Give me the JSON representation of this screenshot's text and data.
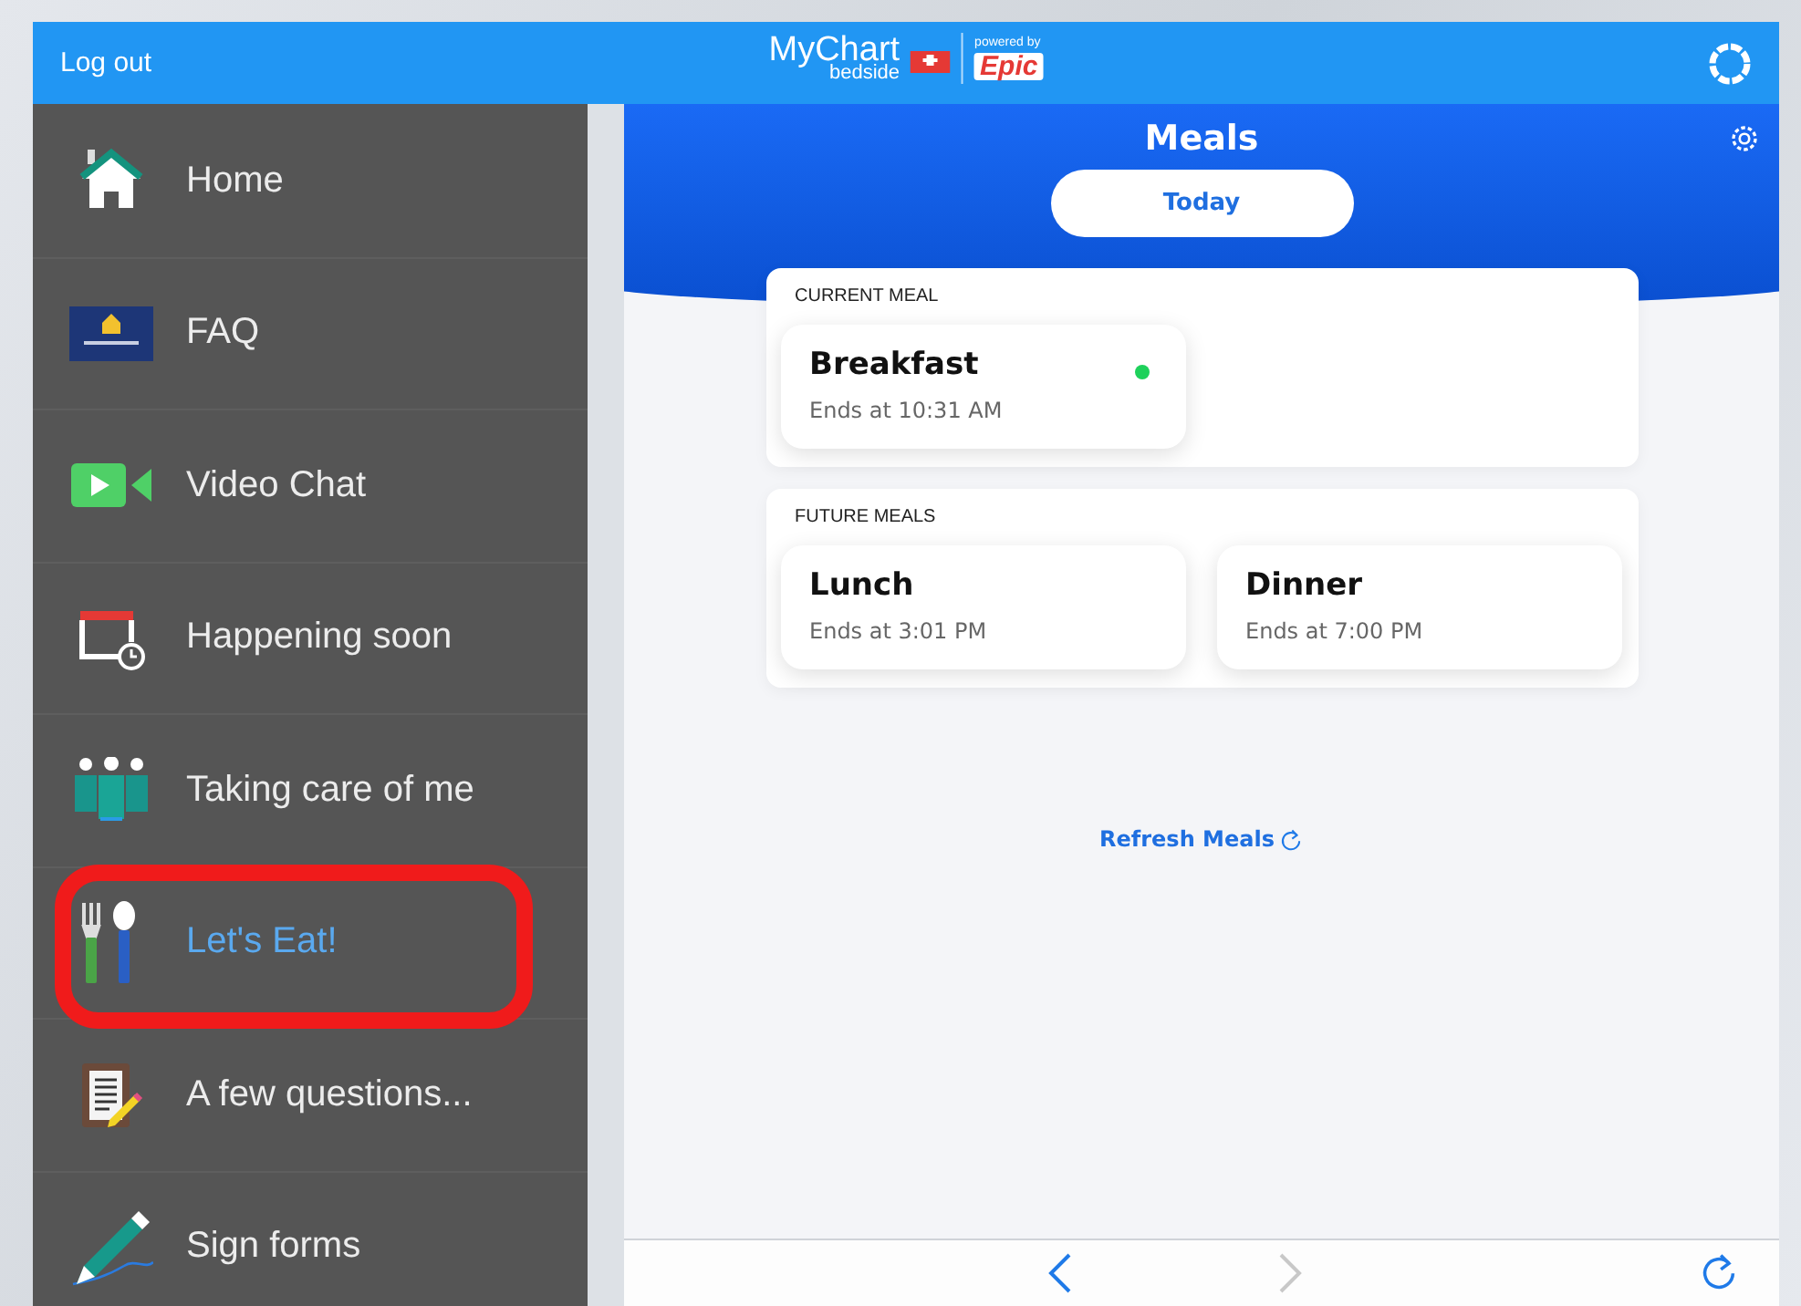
{
  "top_bar": {
    "logout": "Log out",
    "logo": {
      "name": "MyChart",
      "sub": "bedside",
      "powered": "powered by",
      "vendor": "Epic"
    }
  },
  "sidebar": {
    "items": [
      {
        "label": "Home",
        "selected": false,
        "highlighted": false
      },
      {
        "label": "FAQ",
        "selected": false,
        "highlighted": false
      },
      {
        "label": "Video Chat",
        "selected": false,
        "highlighted": false
      },
      {
        "label": "Happening soon",
        "selected": false,
        "highlighted": false
      },
      {
        "label": "Taking care of me",
        "selected": false,
        "highlighted": false
      },
      {
        "label": "Let's Eat!",
        "selected": true,
        "highlighted": true
      },
      {
        "label": "A few questions...",
        "selected": false,
        "highlighted": false
      },
      {
        "label": "Sign forms",
        "selected": false,
        "highlighted": false
      }
    ]
  },
  "meals": {
    "title": "Meals",
    "day_button": "Today",
    "sections": [
      {
        "heading": "CURRENT MEAL",
        "meals": [
          {
            "name": "Breakfast",
            "ends": "Ends at 10:31 AM",
            "active": true
          }
        ]
      },
      {
        "heading": "FUTURE MEALS",
        "meals": [
          {
            "name": "Lunch",
            "ends": "Ends at 3:01 PM",
            "active": false
          },
          {
            "name": "Dinner",
            "ends": "Ends at 7:00 PM",
            "active": false
          }
        ]
      }
    ],
    "refresh": "Refresh Meals"
  },
  "browser_toolbar": {
    "back": {
      "disabled": false
    },
    "forward": {
      "disabled": true
    }
  }
}
